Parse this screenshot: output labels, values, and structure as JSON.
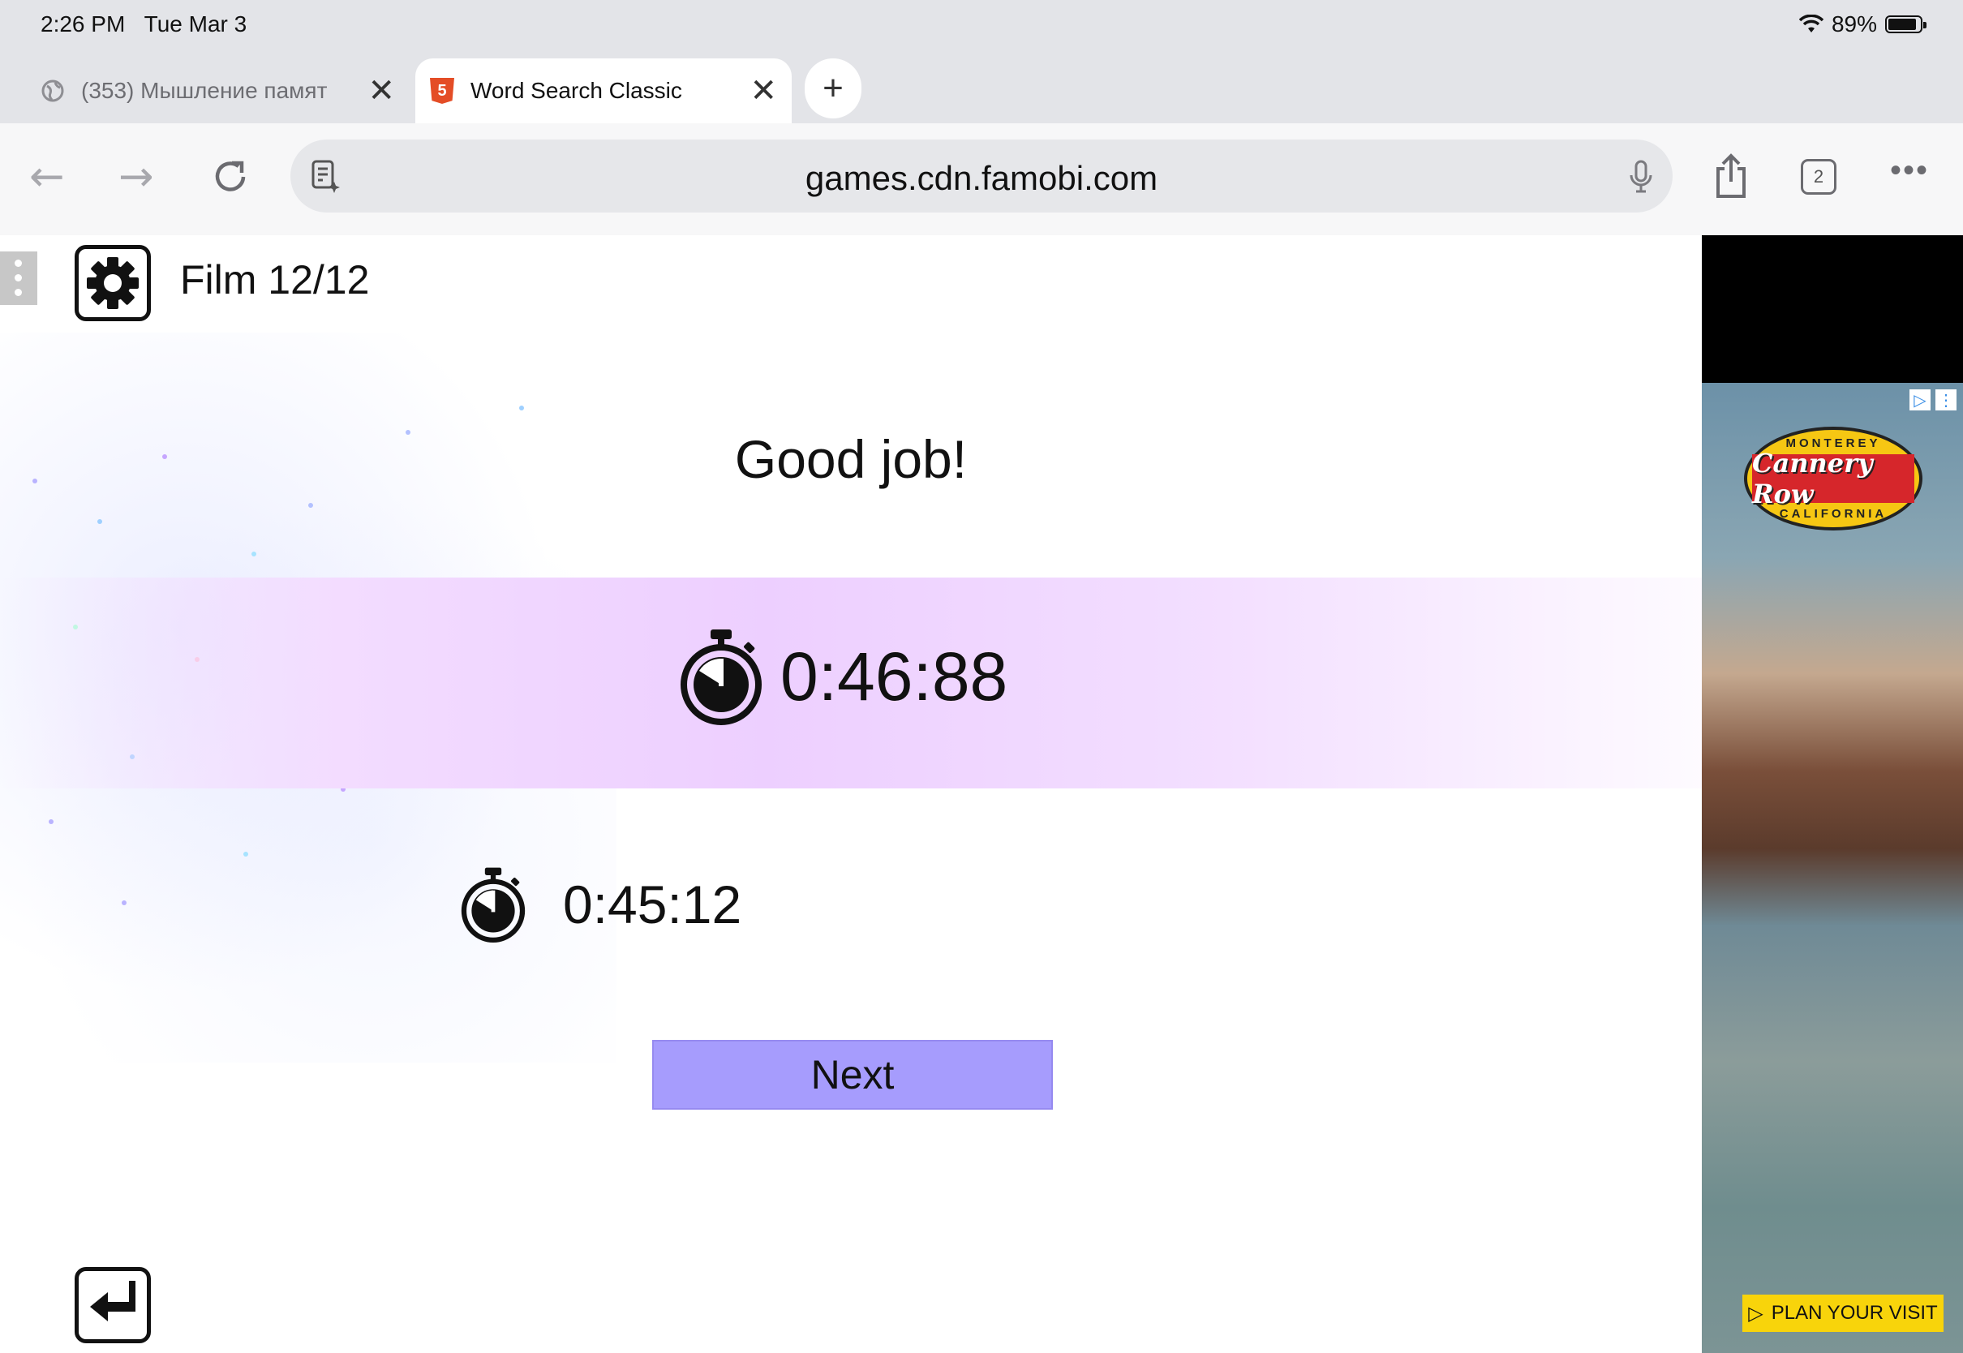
{
  "status_bar": {
    "time": "2:26 PM",
    "date": "Tue Mar 3",
    "battery": "89%"
  },
  "tabs": [
    {
      "title": "(353) Мышление памят",
      "active": false
    },
    {
      "title": "Word Search Classic",
      "active": true
    }
  ],
  "toolbar": {
    "url": "games.cdn.famobi.com",
    "tab_count": "2"
  },
  "game": {
    "level": "Film 12/12",
    "headline": "Good job!",
    "current_time": "0:46:88",
    "best_time": "0:45:12",
    "next_label": "Next"
  },
  "ad": {
    "logo_top": "MONTEREY",
    "logo_main": "Cannery Row",
    "logo_bottom": "CALIFORNIA",
    "cta": "PLAN YOUR VISIT"
  },
  "colors": {
    "next_button": "#a69cfd",
    "band": "#edcfff",
    "html5": "#e44d26",
    "ad_cta": "#f8d40b"
  }
}
